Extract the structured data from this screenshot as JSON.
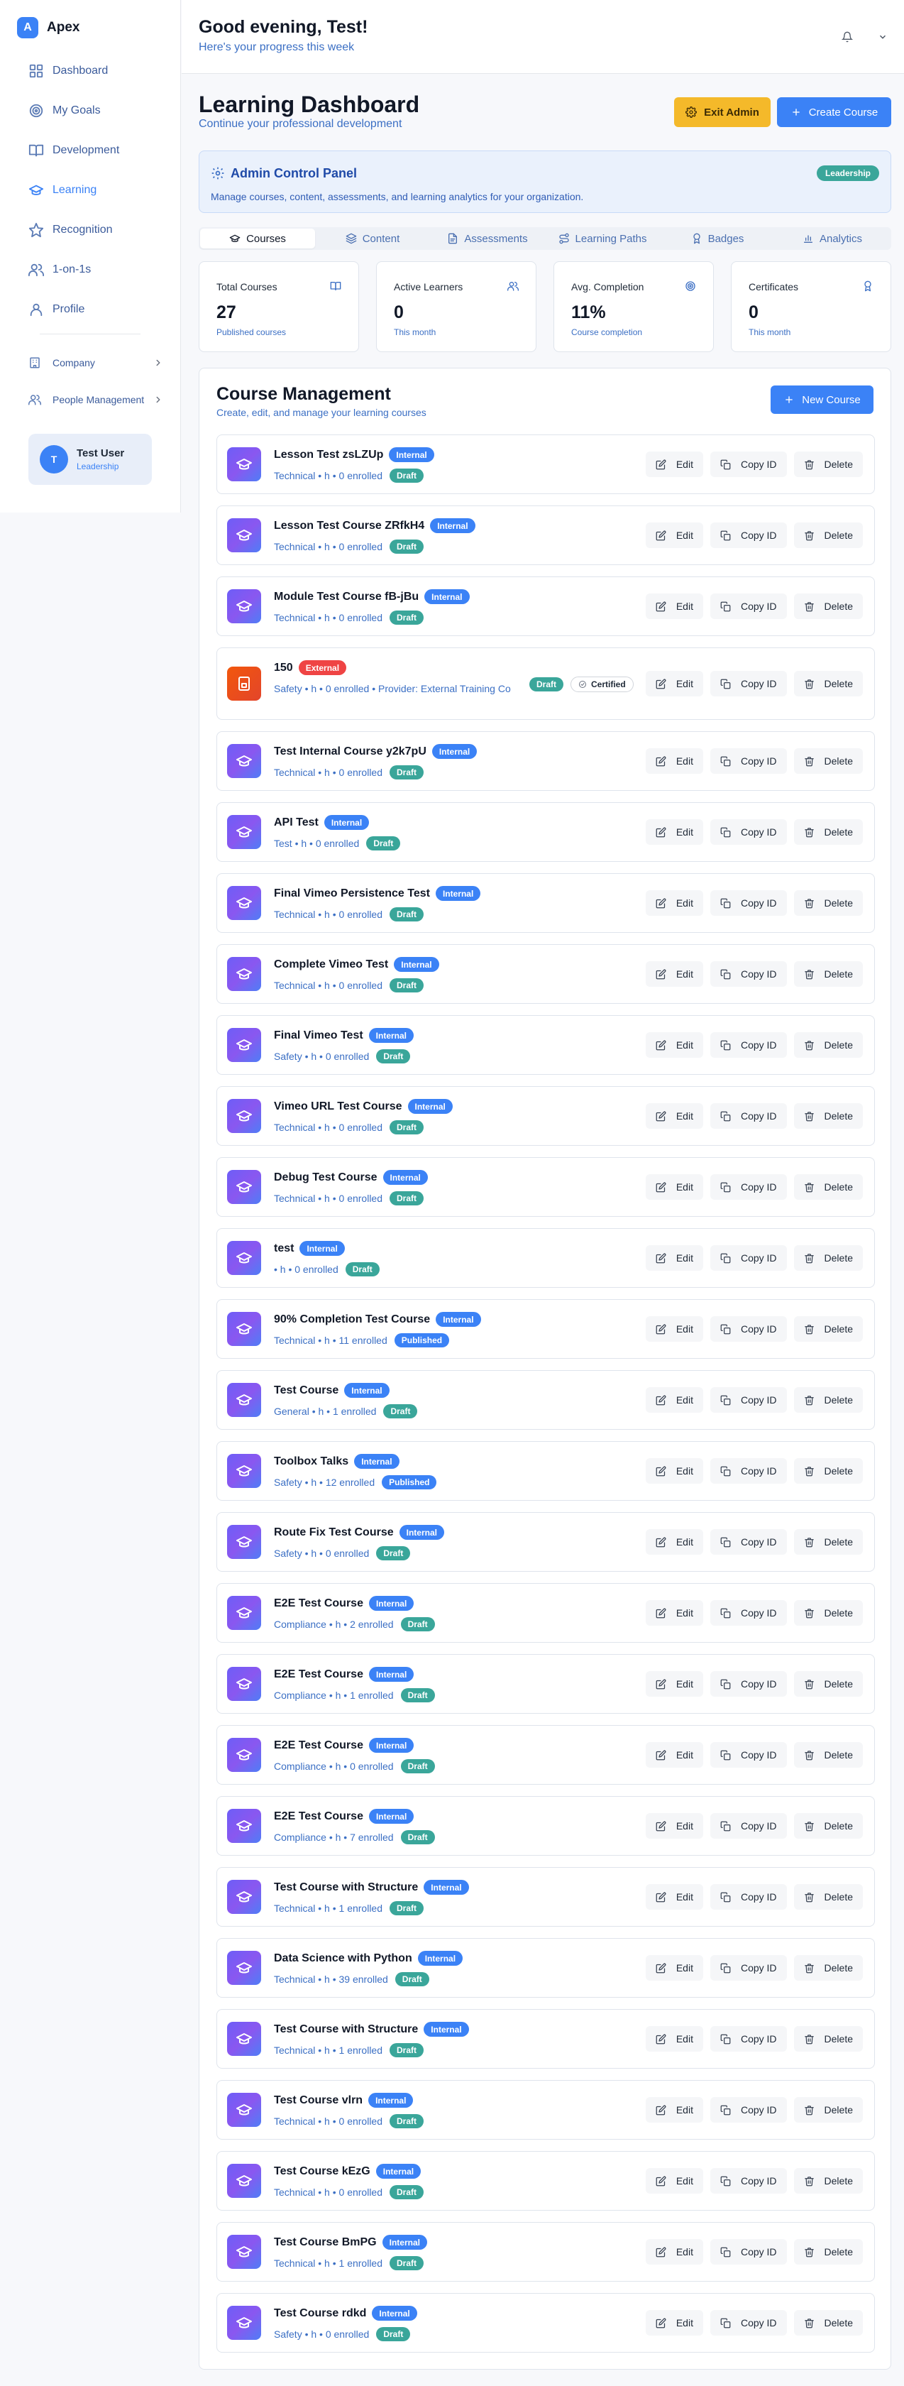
{
  "app": {
    "name": "Apex",
    "logo_letter": "A"
  },
  "sidebar": {
    "items": [
      {
        "label": "Dashboard",
        "icon": "grid-icon"
      },
      {
        "label": "My Goals",
        "icon": "target-icon"
      },
      {
        "label": "Development",
        "icon": "book-icon"
      },
      {
        "label": "Learning",
        "icon": "graduation-cap-icon",
        "active": true
      },
      {
        "label": "Recognition",
        "icon": "star-icon"
      },
      {
        "label": "1-on-1s",
        "icon": "users-icon"
      },
      {
        "label": "Profile",
        "icon": "user-icon"
      }
    ],
    "groups": [
      {
        "label": "Company",
        "icon": "building-icon"
      },
      {
        "label": "People Management",
        "icon": "users-icon"
      }
    ],
    "user": {
      "initial": "T",
      "name": "Test User",
      "role": "Leadership"
    }
  },
  "header": {
    "greeting": "Good evening, Test!",
    "subtitle": "Here's your progress this week"
  },
  "page": {
    "title": "Learning Dashboard",
    "subtitle": "Continue your professional development",
    "exit_admin_label": "Exit Admin",
    "create_course_label": "Create Course"
  },
  "admin_panel": {
    "title": "Admin Control Panel",
    "description": "Manage courses, content, assessments, and learning analytics for your organization.",
    "badge": "Leadership"
  },
  "tabs": [
    {
      "label": "Courses",
      "active": true
    },
    {
      "label": "Content"
    },
    {
      "label": "Assessments"
    },
    {
      "label": "Learning Paths"
    },
    {
      "label": "Badges"
    },
    {
      "label": "Analytics"
    }
  ],
  "stats": [
    {
      "label": "Total Courses",
      "value": "27",
      "sub": "Published courses",
      "icon": "book-icon"
    },
    {
      "label": "Active Learners",
      "value": "0",
      "sub": "This month",
      "icon": "users-icon"
    },
    {
      "label": "Avg. Completion",
      "value": "11%",
      "sub": "Course completion",
      "icon": "target-icon"
    },
    {
      "label": "Certificates",
      "value": "0",
      "sub": "This month",
      "icon": "award-icon"
    }
  ],
  "course_management": {
    "title": "Course Management",
    "subtitle": "Create, edit, and manage your learning courses",
    "new_course_label": "New Course",
    "action_labels": {
      "edit": "Edit",
      "copy": "Copy ID",
      "delete": "Delete"
    },
    "courses": [
      {
        "title": "Lesson Test zsLZUp",
        "source": "Internal",
        "meta": "Technical • h • 0 enrolled",
        "status": "Draft"
      },
      {
        "title": "Lesson Test Course ZRfkH4",
        "source": "Internal",
        "meta": "Technical • h • 0 enrolled",
        "status": "Draft"
      },
      {
        "title": "Module Test Course fB-jBu",
        "source": "Internal",
        "meta": "Technical • h • 0 enrolled",
        "status": "Draft"
      },
      {
        "title": "150",
        "source": "External",
        "meta": "Safety • h • 0 enrolled • Provider: External Training Co",
        "status": "Draft",
        "certified": "Certified"
      },
      {
        "title": "Test Internal Course y2k7pU",
        "source": "Internal",
        "meta": "Technical • h • 0 enrolled",
        "status": "Draft"
      },
      {
        "title": "API Test",
        "source": "Internal",
        "meta": "Test • h • 0 enrolled",
        "status": "Draft"
      },
      {
        "title": "Final Vimeo Persistence Test",
        "source": "Internal",
        "meta": "Technical • h • 0 enrolled",
        "status": "Draft"
      },
      {
        "title": "Complete Vimeo Test",
        "source": "Internal",
        "meta": "Technical • h • 0 enrolled",
        "status": "Draft"
      },
      {
        "title": "Final Vimeo Test",
        "source": "Internal",
        "meta": "Safety • h • 0 enrolled",
        "status": "Draft"
      },
      {
        "title": "Vimeo URL Test Course",
        "source": "Internal",
        "meta": "Technical • h • 0 enrolled",
        "status": "Draft"
      },
      {
        "title": "Debug Test Course",
        "source": "Internal",
        "meta": "Technical • h • 0 enrolled",
        "status": "Draft"
      },
      {
        "title": "test",
        "source": "Internal",
        "meta": "• h • 0 enrolled",
        "status": "Draft"
      },
      {
        "title": "90% Completion Test Course",
        "source": "Internal",
        "meta": "Technical • h • 11 enrolled",
        "status": "Published"
      },
      {
        "title": "Test Course",
        "source": "Internal",
        "meta": "General • h • 1 enrolled",
        "status": "Draft"
      },
      {
        "title": "Toolbox Talks",
        "source": "Internal",
        "meta": "Safety • h • 12 enrolled",
        "status": "Published"
      },
      {
        "title": "Route Fix Test Course",
        "source": "Internal",
        "meta": "Safety • h • 0 enrolled",
        "status": "Draft"
      },
      {
        "title": "E2E Test Course",
        "source": "Internal",
        "meta": "Compliance • h • 2 enrolled",
        "status": "Draft"
      },
      {
        "title": "E2E Test Course",
        "source": "Internal",
        "meta": "Compliance • h • 1 enrolled",
        "status": "Draft"
      },
      {
        "title": "E2E Test Course",
        "source": "Internal",
        "meta": "Compliance • h • 0 enrolled",
        "status": "Draft"
      },
      {
        "title": "E2E Test Course",
        "source": "Internal",
        "meta": "Compliance • h • 7 enrolled",
        "status": "Draft"
      },
      {
        "title": "Test Course with Structure",
        "source": "Internal",
        "meta": "Technical • h • 1 enrolled",
        "status": "Draft"
      },
      {
        "title": "Data Science with Python",
        "source": "Internal",
        "meta": "Technical • h • 39 enrolled",
        "status": "Draft"
      },
      {
        "title": "Test Course with Structure",
        "source": "Internal",
        "meta": "Technical • h • 1 enrolled",
        "status": "Draft"
      },
      {
        "title": "Test Course vlrn",
        "source": "Internal",
        "meta": "Technical • h • 0 enrolled",
        "status": "Draft"
      },
      {
        "title": "Test Course kEzG",
        "source": "Internal",
        "meta": "Technical • h • 0 enrolled",
        "status": "Draft"
      },
      {
        "title": "Test Course BmPG",
        "source": "Internal",
        "meta": "Technical • h • 1 enrolled",
        "status": "Draft"
      },
      {
        "title": "Test Course rdkd",
        "source": "Internal",
        "meta": "Safety • h • 0 enrolled",
        "status": "Draft"
      }
    ]
  },
  "colors": {
    "accent": "#3b82f6",
    "warning": "#f4b92a",
    "draft": "#3aa69a",
    "external": "#ef4444"
  }
}
